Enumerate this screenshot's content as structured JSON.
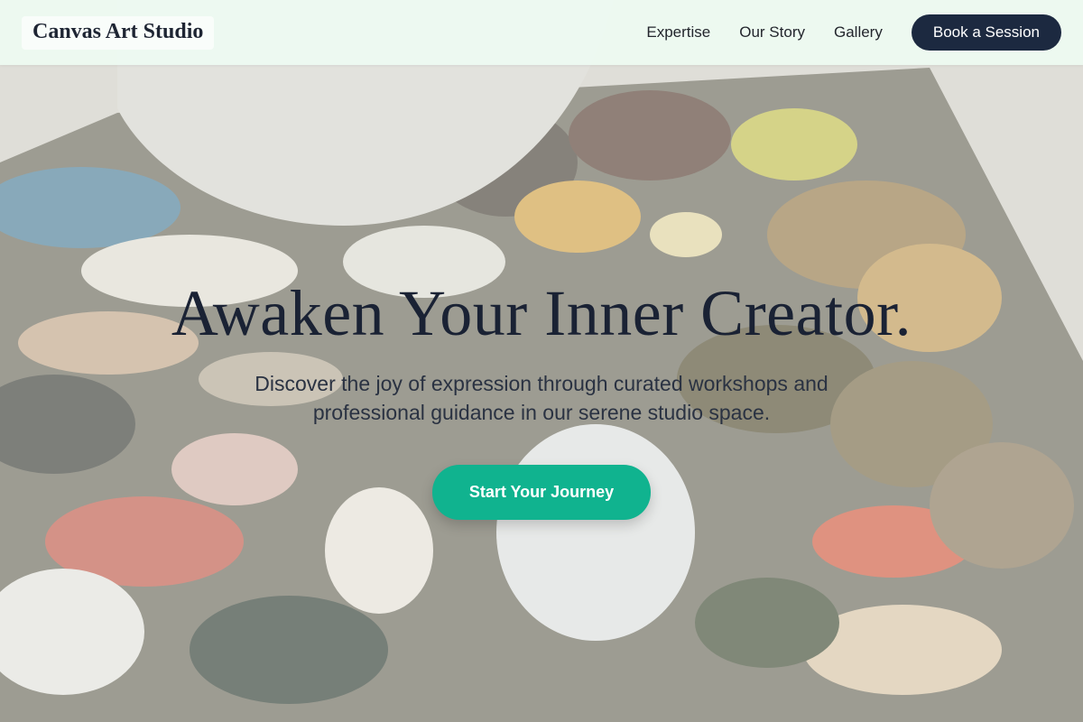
{
  "brand": {
    "name": "Canvas Art Studio"
  },
  "nav": {
    "links": [
      {
        "label": "Expertise"
      },
      {
        "label": "Our Story"
      },
      {
        "label": "Gallery"
      }
    ],
    "cta_label": "Book a Session"
  },
  "hero": {
    "title": "Awaken Your Inner Creator.",
    "subtitle": "Discover the joy of expression through curated workshops and professional guidance in our serene studio space.",
    "cta_label": "Start Your Journey",
    "background_image": "paint-palette-photo"
  },
  "colors": {
    "nav_background": "#eefbf2",
    "nav_cta": "#1c2940",
    "hero_cta": "#10b38f",
    "heading_text": "#1a2234"
  }
}
